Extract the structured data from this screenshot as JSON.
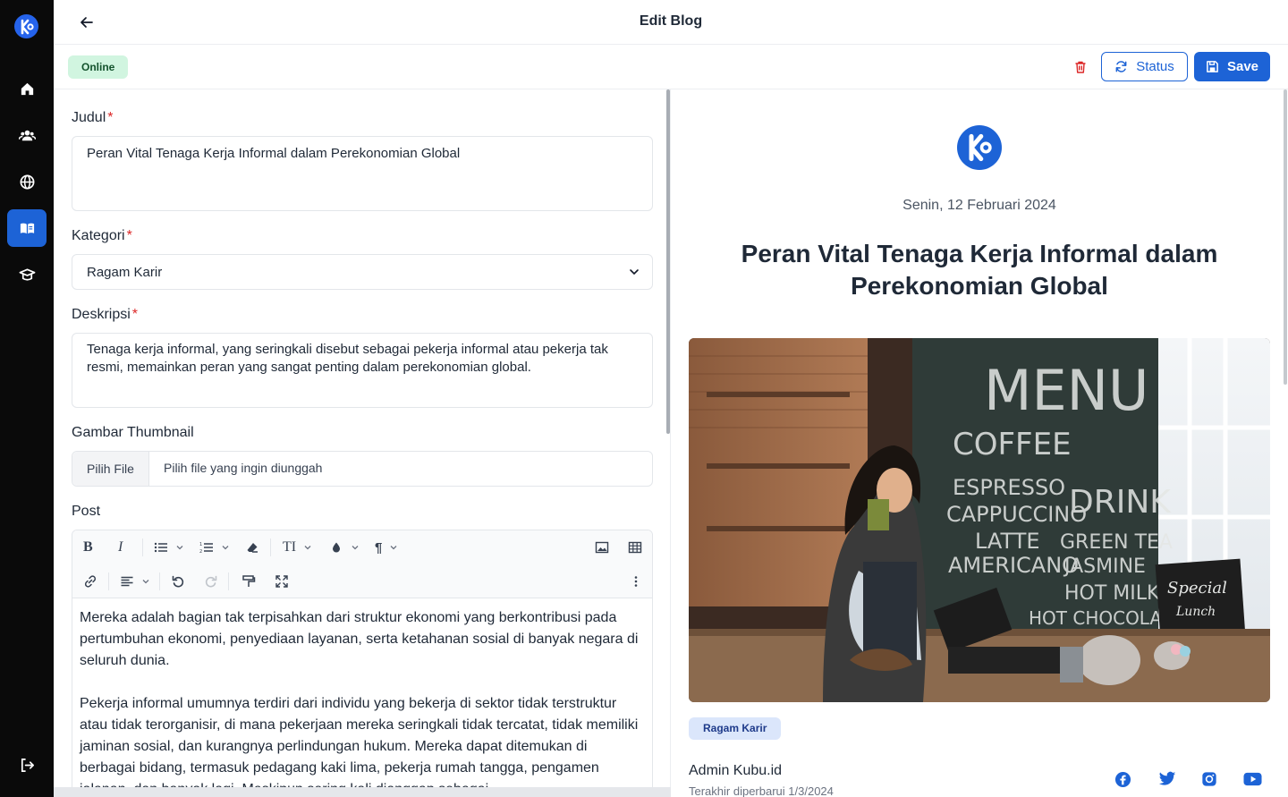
{
  "header": {
    "title": "Edit Blog"
  },
  "sidebar": {
    "items": [
      {
        "name": "home-icon"
      },
      {
        "name": "users-icon"
      },
      {
        "name": "globe-icon"
      },
      {
        "name": "book-open-icon",
        "active": true
      },
      {
        "name": "graduation-cap-icon"
      }
    ],
    "bottom": {
      "name": "logout-icon"
    }
  },
  "actions": {
    "status_badge": "Online",
    "status_label": "Status",
    "save_label": "Save"
  },
  "form": {
    "judul": {
      "label": "Judul",
      "value": "Peran Vital Tenaga Kerja Informal dalam Perekonomian Global"
    },
    "kategori": {
      "label": "Kategori",
      "value": "Ragam Karir"
    },
    "deskripsi": {
      "label": "Deskripsi",
      "value": "Tenaga kerja informal, yang seringkali disebut sebagai pekerja informal atau pekerja tak resmi, memainkan peran yang sangat penting dalam perekonomian global."
    },
    "thumbnail": {
      "label": "Gambar Thumbnail",
      "button": "Pilih File",
      "placeholder": "Pilih file yang ingin diunggah"
    },
    "post": {
      "label": "Post",
      "paragraphs": [
        "Mereka adalah bagian tak terpisahkan dari struktur ekonomi yang berkontribusi pada pertumbuhan ekonomi, penyediaan layanan, serta ketahanan sosial di banyak negara di seluruh dunia.",
        "Pekerja informal umumnya terdiri dari individu yang bekerja di sektor tidak terstruktur atau tidak terorganisir, di mana pekerjaan mereka seringkali tidak tercatat, tidak memiliki jaminan sosial, dan kurangnya perlindungan hukum. Mereka dapat ditemukan di berbagai bidang, termasuk pedagang kaki lima, pekerja rumah tangga, pengamen jalanan, dan banyak lagi. Meskipun sering kali dianggap sebagai"
      ]
    }
  },
  "preview": {
    "date": "Senin, 12 Februari 2024",
    "title": "Peran Vital Tenaga Kerja Informal dalam Perekonomian Global",
    "tag": "Ragam Karir",
    "author": "Admin Kubu.id",
    "updated": "Terakhir diperbarui 1/3/2024",
    "image_menu_words": [
      "MENU",
      "COFFEE",
      "ESPRESSO",
      "CAPPUCCINO",
      "LATTE",
      "AMERICANO",
      "DRINK",
      "GREEN TEA",
      "JASMINE",
      "HOT MILK",
      "HOT CHOCOLATE",
      "Special",
      "Lunch"
    ],
    "social": [
      "facebook-icon",
      "twitter-icon",
      "instagram-icon",
      "youtube-icon"
    ]
  },
  "colors": {
    "primary": "#1d63d6",
    "sidebar_bg": "#0a0a0a",
    "danger": "#dc2626",
    "online_bg": "#d1f5e0"
  }
}
